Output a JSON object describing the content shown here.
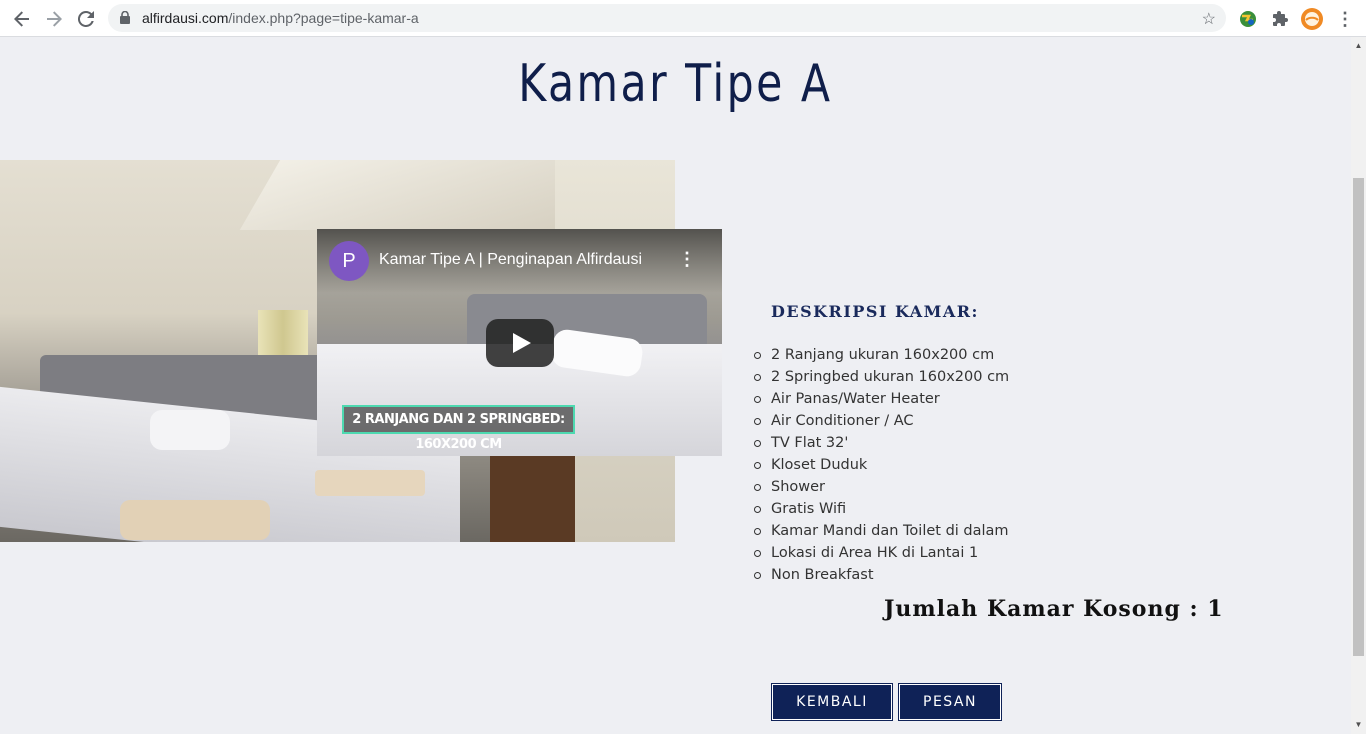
{
  "browser": {
    "url_host": "alfirdausi.com",
    "url_path": "/index.php?page=tipe-kamar-a",
    "icons": [
      "back-icon",
      "forward-icon",
      "reload-icon",
      "lock-icon",
      "star-icon",
      "globe-extension-icon",
      "puzzle-icon",
      "profile-avatar-icon",
      "kebab-menu-icon"
    ]
  },
  "page": {
    "title": "Kamar Tipe A"
  },
  "video": {
    "channel_initial": "P",
    "title": "Kamar Tipe A | Penginapan Alfirdausi",
    "caption": "2 RANJANG DAN 2 SPRINGBED: 160X200 CM"
  },
  "description": {
    "heading": "DESKRIPSI KAMAR:",
    "items": [
      "2 Ranjang ukuran 160x200 cm",
      "2 Springbed ukuran 160x200 cm",
      "Air Panas/Water Heater",
      "Air Conditioner / AC",
      "TV Flat 32'",
      "Kloset Duduk",
      "Shower",
      "Gratis Wifi",
      "Kamar Mandi dan Toilet di dalam",
      "Lokasi di Area HK di Lantai 1",
      "Non Breakfast"
    ],
    "room_count": "Jumlah Kamar Kosong : 1"
  },
  "buttons": {
    "back": "KEMBALI",
    "order": "PESAN"
  },
  "colors": {
    "brand_navy": "#0f2257",
    "page_bg": "#eeeff3",
    "caption_border": "#4dd9b0",
    "avatar": "#7e57c2"
  }
}
